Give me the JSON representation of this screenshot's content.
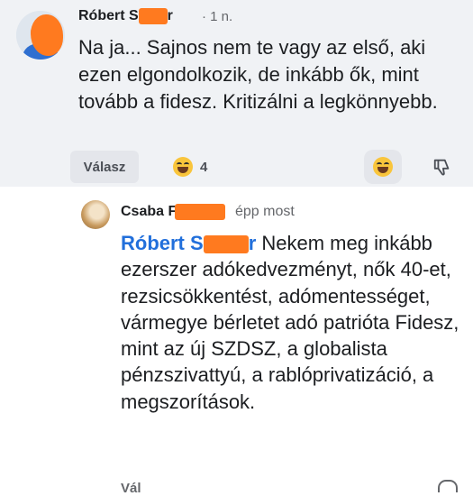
{
  "comment": {
    "author": "Róbert S",
    "author_suffix": "r",
    "time": "· 1 n.",
    "text": "Na ja... Sajnos nem te vagy az első, aki ezen elgondolkozik, de inkább ők, mint tovább a fidesz. Kritizálni a legkönnyebb.",
    "reply_label": "Válasz",
    "reaction_count": "4",
    "reaction_icon": "haha-emoji-icon",
    "dislike_icon": "thumbs-down-icon"
  },
  "reply": {
    "author": "Csaba F",
    "time": "épp most",
    "mention_prefix": "Róbert S",
    "mention_suffix": "r",
    "text": "Nekem meg inkább ezerszer adókedvezményt, nők 40-et, rezsicsökkentést, adómentességet, vármegye bérletet adó patrióta Fidesz, mint az új SZDSZ, a globalista pénzszivattyú, a rablóprivatizáció, a megszorítások.",
    "reply_label_cut": "Vál"
  },
  "colors": {
    "mention": "#216fdb",
    "redaction": "#ff7a1f",
    "top_background": "#f0f2f5"
  }
}
